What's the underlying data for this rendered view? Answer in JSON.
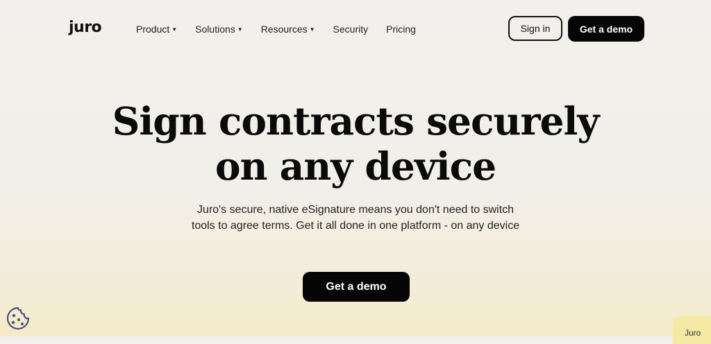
{
  "header": {
    "logo": "juro",
    "nav": [
      {
        "label": "Product",
        "dropdown": true
      },
      {
        "label": "Solutions",
        "dropdown": true
      },
      {
        "label": "Resources",
        "dropdown": true
      },
      {
        "label": "Security",
        "dropdown": false
      },
      {
        "label": "Pricing",
        "dropdown": false
      }
    ],
    "signin_label": "Sign in",
    "demo_label": "Get a demo"
  },
  "hero": {
    "title_line1": "Sign contracts securely",
    "title_line2": "on any device",
    "subtitle": "Juro's secure, native eSignature means you don't need to switch tools to agree terms. Get it all done in one platform - on any device",
    "cta_label": "Get a demo"
  },
  "widgets": {
    "chat_label": "Juro",
    "cookie_icon": "cookie-icon"
  },
  "colors": {
    "primary": "#050505",
    "background": "#f2f0ec",
    "chat_tab": "#f6e9a5",
    "cookie": "#4a4f82"
  }
}
